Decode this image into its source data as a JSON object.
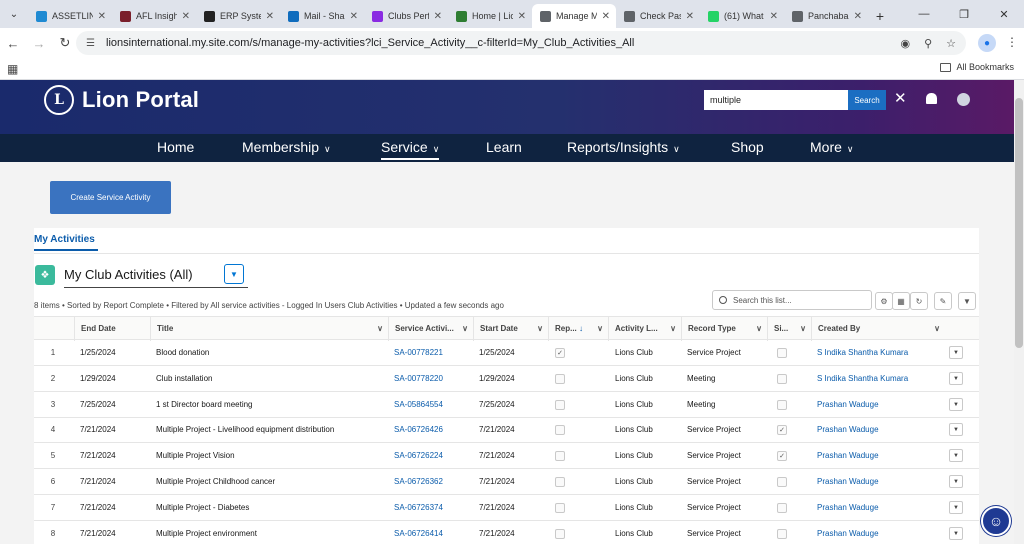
{
  "browser": {
    "tabs": [
      {
        "title": "ASSETLINE",
        "color": "#1f8ad2"
      },
      {
        "title": "AFL Insigh",
        "color": "#7a1f2b"
      },
      {
        "title": "ERP Syster",
        "color": "#222222"
      },
      {
        "title": "Mail - Shar",
        "color": "#0f6cbd"
      },
      {
        "title": "Clubs Perfc",
        "color": "#8a2be2"
      },
      {
        "title": "Home | Lio",
        "color": "#2e7d32"
      },
      {
        "title": "Manage M",
        "color": "#5f6368",
        "active": true
      },
      {
        "title": "Check Pas",
        "color": "#5f6368"
      },
      {
        "title": "(61) What",
        "color": "#25d366"
      },
      {
        "title": "Panchabal",
        "color": "#5f6368"
      }
    ],
    "url": "lionsinternational.my.site.com/s/manage-my-activities?lci_Service_Activity__c-filterId=My_Club_Activities_All",
    "all_bookmarks": "All Bookmarks"
  },
  "portal": {
    "logo_text": "Lion Portal",
    "logo_mark": "L",
    "search_value": "multiple",
    "search_button": "Search",
    "nav": [
      {
        "label": "Home",
        "chevron": false
      },
      {
        "label": "Membership",
        "chevron": true
      },
      {
        "label": "Service",
        "chevron": true,
        "active": true
      },
      {
        "label": "Learn",
        "chevron": false
      },
      {
        "label": "Reports/Insights",
        "chevron": true
      },
      {
        "label": "Shop",
        "chevron": false
      },
      {
        "label": "More",
        "chevron": true
      }
    ]
  },
  "page": {
    "create_button": "Create Service Activity",
    "tab_label": "My Activities",
    "list_view_title": "My Club Activities (All)",
    "meta": "8 items • Sorted by Report Complete • Filtered by All service activities - Logged In Users Club Activities • Updated a few seconds ago",
    "search_placeholder": "Search this list..."
  },
  "table": {
    "columns": [
      "End Date",
      "Title",
      "Service Activi...",
      "Start Date",
      "Rep...",
      "Activity L...",
      "Record Type",
      "Si...",
      "Created By"
    ],
    "rows": [
      {
        "n": "1",
        "end": "1/25/2024",
        "title": "Blood donation",
        "sa": "SA-00778221",
        "start": "1/25/2024",
        "rep": true,
        "level": "Lions Club",
        "type": "Service Project",
        "si": false,
        "by": "S Indika Shantha Kumara"
      },
      {
        "n": "2",
        "end": "1/29/2024",
        "title": "Club installation",
        "sa": "SA-00778220",
        "start": "1/29/2024",
        "rep": false,
        "level": "Lions Club",
        "type": "Meeting",
        "si": false,
        "by": "S Indika Shantha Kumara"
      },
      {
        "n": "3",
        "end": "7/25/2024",
        "title": "1 st Director board meeting",
        "sa": "SA-05864554",
        "start": "7/25/2024",
        "rep": false,
        "level": "Lions Club",
        "type": "Meeting",
        "si": false,
        "by": "Prashan Waduge"
      },
      {
        "n": "4",
        "end": "7/21/2024",
        "title": "Multiple Project - Livelihood equipment distribution",
        "sa": "SA-06726426",
        "start": "7/21/2024",
        "rep": false,
        "level": "Lions Club",
        "type": "Service Project",
        "si": true,
        "by": "Prashan Waduge"
      },
      {
        "n": "5",
        "end": "7/21/2024",
        "title": "Multiple Project Vision",
        "sa": "SA-06726224",
        "start": "7/21/2024",
        "rep": false,
        "level": "Lions Club",
        "type": "Service Project",
        "si": true,
        "by": "Prashan Waduge"
      },
      {
        "n": "6",
        "end": "7/21/2024",
        "title": "Multiple Project Childhood cancer",
        "sa": "SA-06726362",
        "start": "7/21/2024",
        "rep": false,
        "level": "Lions Club",
        "type": "Service Project",
        "si": false,
        "by": "Prashan Waduge"
      },
      {
        "n": "7",
        "end": "7/21/2024",
        "title": "Multiple Project - Diabetes",
        "sa": "SA-06726374",
        "start": "7/21/2024",
        "rep": false,
        "level": "Lions Club",
        "type": "Service Project",
        "si": false,
        "by": "Prashan Waduge"
      },
      {
        "n": "8",
        "end": "7/21/2024",
        "title": "Multiple Project environment",
        "sa": "SA-06726414",
        "start": "7/21/2024",
        "rep": false,
        "level": "Lions Club",
        "type": "Service Project",
        "si": false,
        "by": "Prashan Waduge"
      }
    ]
  }
}
